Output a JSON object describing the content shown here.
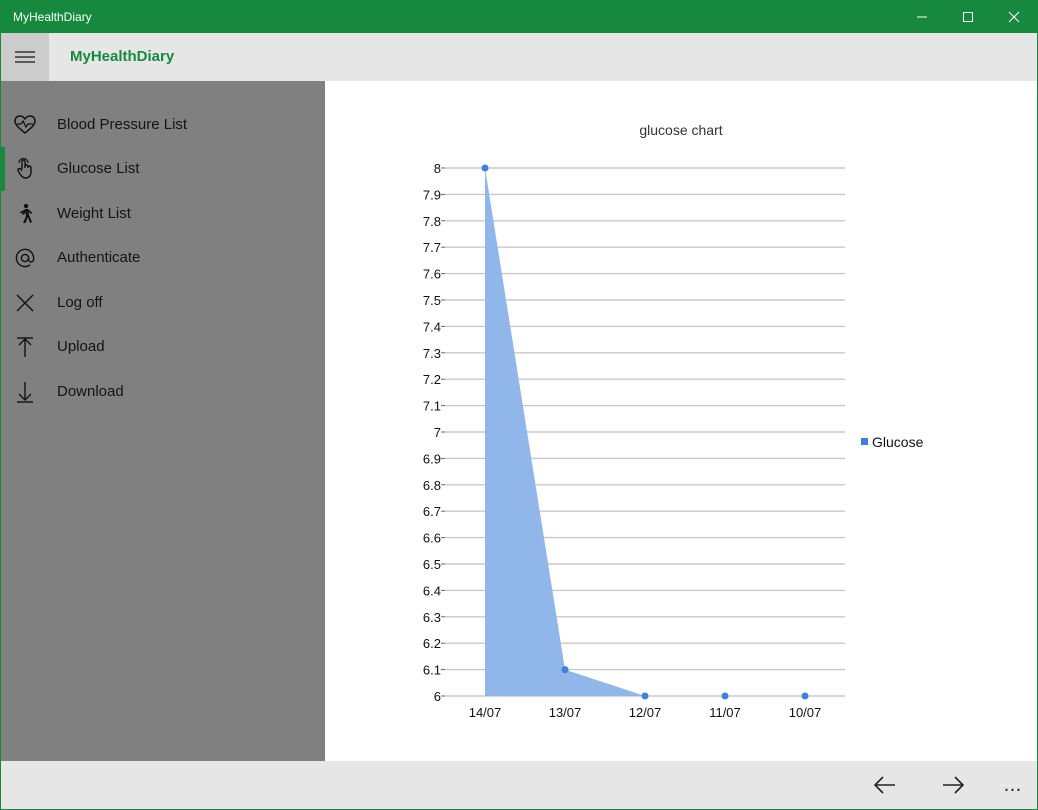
{
  "window": {
    "title": "MyHealthDiary"
  },
  "header": {
    "app_name": "MyHealthDiary"
  },
  "sidebar": {
    "items": [
      {
        "label": "Blood Pressure List",
        "icon": "heart-pulse-icon"
      },
      {
        "label": "Glucose List",
        "icon": "touch-hand-icon",
        "selected": true
      },
      {
        "label": "Weight List",
        "icon": "walking-person-icon"
      },
      {
        "label": "Authenticate",
        "icon": "at-sign-icon"
      },
      {
        "label": "Log off",
        "icon": "close-x-icon"
      },
      {
        "label": "Upload",
        "icon": "upload-arrow-icon"
      },
      {
        "label": "Download",
        "icon": "download-arrow-icon"
      }
    ]
  },
  "bottombar": {
    "more": "…"
  },
  "colors": {
    "accent": "#17893e",
    "sidebar": "#808080",
    "series": "#3f80d8",
    "area": "#8fb6ea"
  },
  "chart_data": {
    "type": "area",
    "title": "glucose chart",
    "categories": [
      "14/07",
      "13/07",
      "12/07",
      "11/07",
      "10/07"
    ],
    "series": [
      {
        "name": "Glucose",
        "values": [
          8,
          6.1,
          6,
          6,
          6
        ]
      }
    ],
    "ylim": [
      6,
      8
    ],
    "yticks": [
      "8",
      "7.9",
      "7.8",
      "7.7",
      "7.6",
      "7.5",
      "7.4",
      "7.3",
      "7.2",
      "7.1",
      "7",
      "6.9",
      "6.8",
      "6.7",
      "6.6",
      "6.5",
      "6.4",
      "6.3",
      "6.2",
      "6.1",
      "6"
    ],
    "grid": true,
    "legend": "right"
  }
}
